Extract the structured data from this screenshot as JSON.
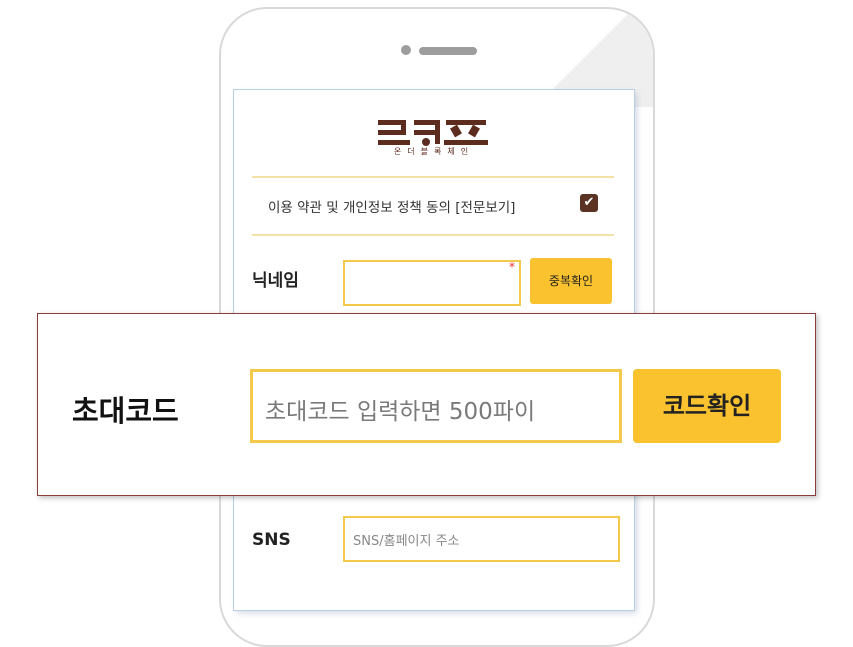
{
  "logo": {
    "main": "코퀴즈",
    "sub": "온더블록체인"
  },
  "terms": {
    "label": "이용 약관 및 개인정보 정책 동의 [전문보기]",
    "checked": true
  },
  "nickname": {
    "label": "닉네임",
    "value": "",
    "required_mark": "*",
    "check_button": "중복확인"
  },
  "invite": {
    "label": "초대코드",
    "placeholder": "초대코드 입력하면 500파이",
    "button": "코드확인"
  },
  "sns": {
    "label": "SNS",
    "placeholder": "SNS/홈페이지 주소"
  },
  "colors": {
    "accent": "#f9c22e",
    "border": "#f3c94b",
    "brand": "#5c2d1f"
  }
}
